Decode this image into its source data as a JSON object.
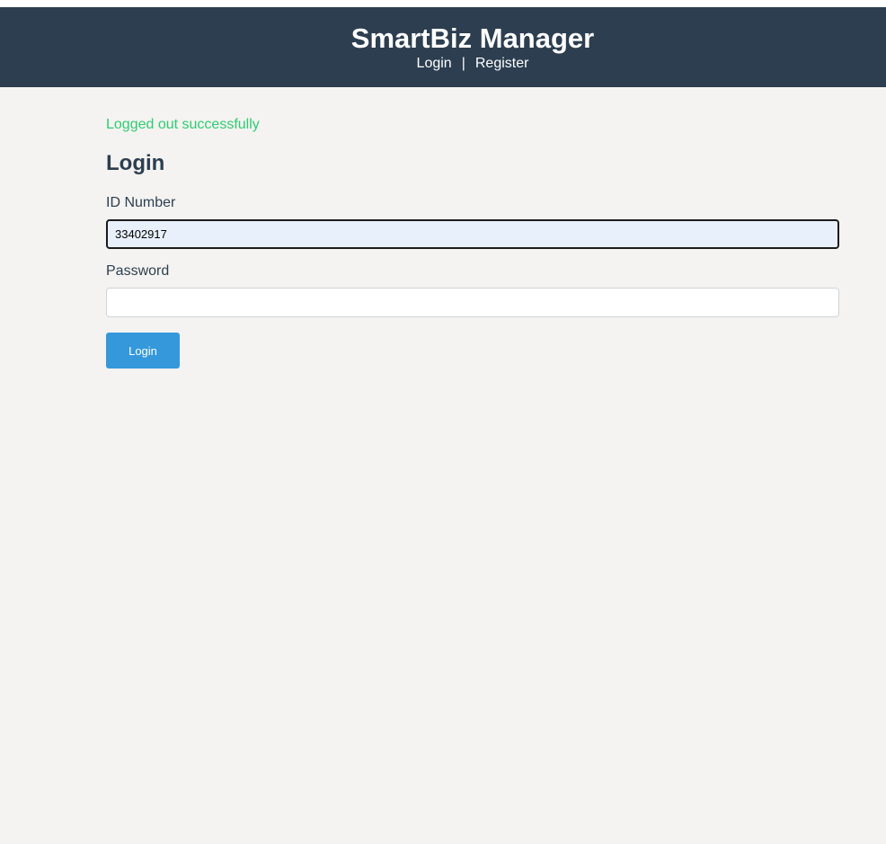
{
  "header": {
    "brand": "SmartBiz Manager",
    "nav": {
      "login_label": "Login",
      "separator": "|",
      "register_label": "Register"
    }
  },
  "flash_message": "Logged out successfully",
  "form": {
    "title": "Login",
    "id_number": {
      "label": "ID Number",
      "value": "33402917"
    },
    "password": {
      "label": "Password",
      "value": ""
    },
    "submit_label": "Login"
  },
  "colors": {
    "header_bg": "#2c3e50",
    "page_bg": "#f4f3f1",
    "success_text": "#2ecc71",
    "primary_button": "#3498db",
    "focused_input_bg": "#e8f0fb"
  }
}
